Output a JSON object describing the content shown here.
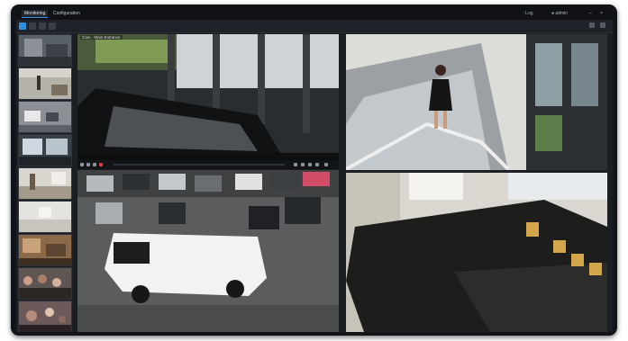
{
  "window": {
    "tabs": [
      {
        "label": "Monitoring",
        "active": true
      },
      {
        "label": "Configuration",
        "active": false
      }
    ],
    "user_label": "Log",
    "account_label": "admin",
    "accent_color": "#2f8fe0",
    "record_color": "#e03a3a"
  },
  "toolbar": {
    "icons": [
      "grid-view-icon",
      "search-icon",
      "camera-icon",
      "pen-icon"
    ]
  },
  "sidebar": {
    "thumbnails": [
      "lobby-thumbnail",
      "corridor-thumbnail",
      "garage-thumbnail",
      "window-thumbnail",
      "entrance-thumbnail",
      "hallway-thumbnail",
      "office-thumbnail",
      "crowd-thumbnail",
      "plaza-thumbnail"
    ]
  },
  "main": {
    "tile_label": "Cam · Main Entrance"
  }
}
